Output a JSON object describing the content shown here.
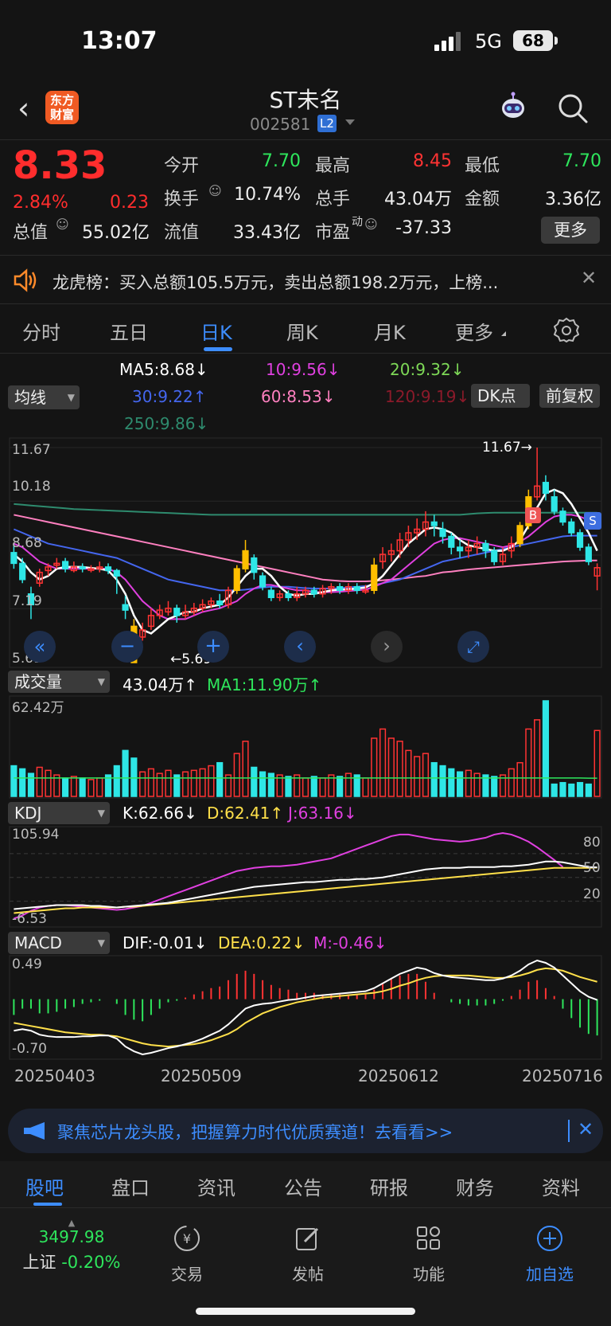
{
  "status": {
    "time": "13:07",
    "network": "5G",
    "battery": "68"
  },
  "header": {
    "stock_name": "ST未名",
    "stock_code": "002581",
    "level_badge": "L2",
    "logo_text": "东方\n财富"
  },
  "quote": {
    "price": "8.33",
    "change_pct": "2.84%",
    "change": "0.23",
    "open_label": "今开",
    "open": "7.70",
    "high_label": "最高",
    "high": "8.45",
    "low_label": "最低",
    "low": "7.70",
    "turnover_label": "换手",
    "turnover": "10.74%",
    "volume_label": "总手",
    "volume": "43.04万",
    "amount_label": "金额",
    "amount": "3.36亿",
    "mktcap_label": "总值",
    "mktcap": "55.02亿",
    "float_label": "流值",
    "float": "33.43亿",
    "pe_label": "市盈",
    "pe_sup": "动",
    "pe": "-37.33",
    "more_label": "更多"
  },
  "notice": {
    "text": "龙虎榜：买入总额105.5万元，卖出总额198.2万元，上榜..."
  },
  "tabs": [
    {
      "label": "分时"
    },
    {
      "label": "五日"
    },
    {
      "label": "日K"
    },
    {
      "label": "周K"
    },
    {
      "label": "月K"
    },
    {
      "label": "更多"
    }
  ],
  "ma_legend": {
    "selector": "均线",
    "ma5": "MA5:8.68↓",
    "ma10": "10:9.56↓",
    "ma20": "20:9.32↓",
    "ma30": "30:9.22↑",
    "ma60": "60:8.53↓",
    "ma120": "120:9.19↓",
    "ma250": "250:9.86↓",
    "dk_button": "DK点",
    "fq_button": "前复权"
  },
  "colors": {
    "up": "#ff3333",
    "down": "#2ee6e6",
    "ma5": "#ffffff",
    "ma10": "#e040e0",
    "ma20": "#7ed957",
    "ma30": "#4466ee",
    "ma60": "#ff80c0",
    "ma120": "#8b1a2a",
    "ma250": "#2e8b6e",
    "accent": "#3d8dff"
  },
  "main_chart": {
    "y_labels": [
      "11.67",
      "10.18",
      "8.68",
      "7.19",
      "5.69"
    ],
    "high_marker": "11.67→",
    "low_marker": "←5.69",
    "b_marker": "B",
    "s_marker": "S"
  },
  "volume": {
    "selector": "成交量",
    "value": "43.04万↑",
    "ma1": "MA1:11.90万↑",
    "max_label": "62.42万"
  },
  "kdj": {
    "selector": "KDJ",
    "k": "K:62.66↓",
    "d": "D:62.41↑",
    "j": "J:63.16↓",
    "top": "105.94",
    "bottom": "-6.53",
    "lv80": "80",
    "lv50": "50",
    "lv20": "20"
  },
  "macd": {
    "selector": "MACD",
    "dif": "DIF:-0.01↓",
    "dea": "DEA:0.22↓",
    "m": "M:-0.46↓",
    "top": "0.49",
    "bottom": "-0.70"
  },
  "dates": [
    "20250403",
    "20250509",
    "20250612",
    "20250716"
  ],
  "chart_data": {
    "type": "candlestick",
    "ylim": [
      5.69,
      11.67
    ],
    "candles": [
      [
        8.75,
        8.45,
        9.0,
        8.3
      ],
      [
        8.45,
        8.0,
        8.6,
        7.9
      ],
      [
        7.6,
        7.3,
        7.8,
        6.9
      ],
      [
        7.9,
        8.2,
        8.3,
        7.8
      ],
      [
        8.25,
        8.35,
        8.45,
        8.1
      ],
      [
        8.4,
        8.45,
        8.6,
        8.3
      ],
      [
        8.5,
        8.3,
        8.6,
        8.2
      ],
      [
        8.25,
        8.35,
        8.5,
        8.2
      ],
      [
        8.35,
        8.3,
        8.45,
        8.2
      ],
      [
        8.3,
        8.3,
        8.4,
        8.2
      ],
      [
        8.3,
        8.35,
        8.5,
        8.2
      ],
      [
        8.35,
        8.25,
        8.45,
        8.15
      ],
      [
        8.25,
        8.1,
        8.3,
        7.6
      ],
      [
        7.3,
        7.15,
        7.55,
        6.9
      ],
      [
        6.7,
        5.69,
        6.9,
        5.69
      ],
      [
        6.4,
        6.6,
        6.8,
        6.3
      ],
      [
        6.7,
        7.0,
        7.2,
        6.6
      ],
      [
        7.0,
        7.15,
        7.3,
        6.9
      ],
      [
        7.1,
        7.2,
        7.4,
        7.0
      ],
      [
        7.2,
        7.0,
        7.3,
        6.8
      ],
      [
        7.0,
        7.1,
        7.3,
        6.9
      ],
      [
        7.1,
        7.2,
        7.35,
        7.0
      ],
      [
        7.2,
        7.3,
        7.45,
        7.1
      ],
      [
        7.3,
        7.4,
        7.5,
        7.2
      ],
      [
        7.4,
        7.3,
        7.6,
        7.2
      ],
      [
        7.3,
        7.7,
        7.8,
        7.2
      ],
      [
        7.7,
        8.3,
        8.4,
        7.6
      ],
      [
        8.3,
        8.8,
        9.1,
        8.2
      ],
      [
        8.6,
        8.2,
        8.7,
        8.0
      ],
      [
        8.1,
        7.8,
        8.2,
        7.7
      ],
      [
        7.7,
        7.5,
        7.8,
        7.4
      ],
      [
        7.5,
        7.6,
        7.7,
        7.4
      ],
      [
        7.6,
        7.5,
        7.7,
        7.4
      ],
      [
        7.5,
        7.6,
        7.8,
        7.4
      ],
      [
        7.6,
        7.7,
        7.8,
        7.5
      ],
      [
        7.7,
        7.6,
        7.8,
        7.5
      ],
      [
        7.6,
        7.75,
        7.85,
        7.5
      ],
      [
        7.75,
        7.8,
        7.9,
        7.6
      ],
      [
        7.8,
        7.7,
        7.9,
        7.6
      ],
      [
        7.7,
        7.8,
        7.9,
        7.6
      ],
      [
        7.8,
        7.7,
        7.9,
        7.6
      ],
      [
        7.7,
        7.7,
        7.85,
        7.6
      ],
      [
        7.7,
        8.4,
        8.6,
        7.6
      ],
      [
        8.5,
        8.7,
        8.9,
        8.3
      ],
      [
        8.7,
        8.8,
        9.0,
        8.5
      ],
      [
        8.8,
        9.1,
        9.3,
        8.6
      ],
      [
        9.1,
        9.3,
        9.5,
        8.9
      ],
      [
        9.3,
        9.4,
        9.7,
        9.1
      ],
      [
        9.4,
        9.6,
        9.9,
        9.2
      ],
      [
        9.6,
        9.5,
        9.8,
        9.2
      ],
      [
        9.4,
        9.2,
        9.6,
        9.0
      ],
      [
        9.2,
        8.9,
        9.3,
        8.7
      ],
      [
        8.9,
        8.8,
        9.1,
        8.6
      ],
      [
        8.8,
        8.9,
        9.1,
        8.6
      ],
      [
        8.9,
        9.0,
        9.2,
        8.7
      ],
      [
        9.0,
        8.8,
        9.1,
        8.6
      ],
      [
        8.8,
        8.5,
        8.9,
        8.4
      ],
      [
        8.5,
        8.7,
        8.9,
        8.4
      ],
      [
        8.8,
        9.0,
        9.2,
        8.6
      ],
      [
        9.0,
        9.5,
        9.6,
        8.9
      ],
      [
        9.5,
        10.3,
        10.5,
        9.4
      ],
      [
        10.3,
        10.6,
        11.67,
        10.2
      ],
      [
        10.7,
        10.4,
        10.9,
        10.2
      ],
      [
        10.3,
        9.9,
        10.5,
        9.8
      ],
      [
        9.9,
        9.6,
        10.0,
        9.5
      ],
      [
        9.6,
        9.3,
        9.7,
        9.2
      ],
      [
        9.3,
        8.9,
        9.4,
        8.8
      ],
      [
        8.9,
        8.5,
        9.0,
        8.4
      ],
      [
        8.1,
        8.33,
        8.45,
        7.7
      ]
    ],
    "ma5": [
      8.7,
      8.5,
      8.2,
      8.0,
      8.1,
      8.3,
      8.35,
      8.35,
      8.35,
      8.32,
      8.3,
      8.25,
      8.0,
      7.6,
      7.0,
      6.6,
      6.5,
      6.7,
      6.9,
      7.0,
      7.1,
      7.1,
      7.2,
      7.25,
      7.3,
      7.5,
      7.8,
      8.1,
      8.3,
      8.3,
      8.1,
      7.8,
      7.6,
      7.55,
      7.6,
      7.6,
      7.65,
      7.7,
      7.72,
      7.73,
      7.75,
      7.78,
      7.9,
      8.1,
      8.4,
      8.7,
      9.0,
      9.2,
      9.4,
      9.45,
      9.4,
      9.3,
      9.1,
      8.95,
      8.9,
      8.85,
      8.8,
      8.8,
      8.9,
      9.1,
      9.5,
      10.0,
      10.4,
      10.5,
      10.4,
      10.1,
      9.7,
      9.3,
      8.8
    ],
    "ma10": [
      9.0,
      8.9,
      8.7,
      8.5,
      8.4,
      8.3,
      8.3,
      8.3,
      8.3,
      8.3,
      8.3,
      8.3,
      8.2,
      8.0,
      7.7,
      7.4,
      7.2,
      7.0,
      6.9,
      6.9,
      6.9,
      7.0,
      7.1,
      7.15,
      7.2,
      7.3,
      7.4,
      7.6,
      7.75,
      7.85,
      7.85,
      7.8,
      7.75,
      7.7,
      7.7,
      7.65,
      7.65,
      7.65,
      7.66,
      7.68,
      7.7,
      7.72,
      7.8,
      7.9,
      8.0,
      8.2,
      8.4,
      8.6,
      8.8,
      9.0,
      9.1,
      9.15,
      9.15,
      9.1,
      9.05,
      9.0,
      8.95,
      8.9,
      8.95,
      9.05,
      9.2,
      9.4,
      9.6,
      9.75,
      9.8,
      9.8,
      9.75,
      9.65,
      9.56
    ],
    "ma30": [
      9.4,
      9.3,
      9.2,
      9.1,
      9.0,
      8.95,
      8.9,
      8.85,
      8.8,
      8.75,
      8.7,
      8.65,
      8.6,
      8.5,
      8.4,
      8.3,
      8.2,
      8.1,
      8.0,
      7.95,
      7.9,
      7.85,
      7.8,
      7.75,
      7.7,
      7.7,
      7.7,
      7.72,
      7.75,
      7.78,
      7.8,
      7.8,
      7.8,
      7.78,
      7.76,
      7.75,
      7.75,
      7.75,
      7.76,
      7.78,
      7.8,
      7.82,
      7.85,
      7.9,
      7.95,
      8.0,
      8.1,
      8.2,
      8.3,
      8.4,
      8.5,
      8.55,
      8.6,
      8.65,
      8.7,
      8.75,
      8.8,
      8.85,
      8.9,
      8.95,
      9.0,
      9.05,
      9.1,
      9.15,
      9.2,
      9.22,
      9.22,
      9.22,
      9.22
    ],
    "ma60": [
      9.8,
      9.75,
      9.7,
      9.65,
      9.6,
      9.55,
      9.5,
      9.45,
      9.4,
      9.35,
      9.3,
      9.25,
      9.2,
      9.15,
      9.1,
      9.05,
      9.0,
      8.95,
      8.9,
      8.85,
      8.8,
      8.75,
      8.7,
      8.65,
      8.6,
      8.55,
      8.5,
      8.45,
      8.4,
      8.35,
      8.3,
      8.25,
      8.2,
      8.15,
      8.1,
      8.05,
      8.0,
      7.98,
      7.96,
      7.95,
      7.95,
      7.95,
      7.96,
      7.98,
      8.0,
      8.02,
      8.05,
      8.08,
      8.1,
      8.15,
      8.2,
      8.22,
      8.25,
      8.28,
      8.3,
      8.32,
      8.34,
      8.36,
      8.38,
      8.4,
      8.42,
      8.44,
      8.46,
      8.48,
      8.5,
      8.51,
      8.52,
      8.53,
      8.53
    ],
    "ma250": [
      10.1,
      10.08,
      10.06,
      10.04,
      10.02,
      10.0,
      9.98,
      9.96,
      9.95,
      9.94,
      9.93,
      9.92,
      9.91,
      9.9,
      9.89,
      9.88,
      9.87,
      9.86,
      9.85,
      9.84,
      9.83,
      9.82,
      9.81,
      9.8,
      9.8,
      9.8,
      9.8,
      9.8,
      9.8,
      9.8,
      9.8,
      9.8,
      9.8,
      9.8,
      9.8,
      9.8,
      9.8,
      9.8,
      9.8,
      9.8,
      9.8,
      9.8,
      9.8,
      9.8,
      9.8,
      9.8,
      9.8,
      9.8,
      9.8,
      9.8,
      9.8,
      9.8,
      9.8,
      9.82,
      9.84,
      9.85,
      9.86,
      9.86,
      9.86,
      9.86,
      9.86,
      9.86,
      9.86,
      9.86,
      9.86,
      9.86,
      9.86,
      9.86,
      9.86
    ],
    "volume": [
      20,
      18,
      15,
      19,
      17,
      14,
      12,
      13,
      12,
      11,
      12,
      14,
      20,
      30,
      25,
      16,
      18,
      15,
      17,
      14,
      16,
      17,
      18,
      20,
      22,
      14,
      28,
      36,
      19,
      16,
      15,
      14,
      13,
      14,
      12,
      13,
      12,
      14,
      13,
      15,
      14,
      12,
      38,
      44,
      38,
      36,
      30,
      26,
      28,
      22,
      20,
      18,
      16,
      17,
      15,
      14,
      13,
      14,
      18,
      22,
      44,
      50,
      62.42,
      8,
      9,
      8,
      9,
      8,
      43.04
    ],
    "volume_ma": [
      12,
      12,
      12,
      12,
      12,
      12,
      12,
      12,
      12,
      12,
      12,
      12,
      12,
      12,
      12,
      12,
      12,
      12,
      12,
      12,
      12,
      12,
      12,
      12,
      12,
      12,
      12,
      12,
      12,
      12,
      12,
      12,
      12,
      12,
      12,
      12,
      12,
      12,
      12,
      12,
      12,
      12,
      12,
      12,
      12,
      12,
      12,
      12,
      12,
      12,
      12,
      12,
      12,
      12,
      12,
      12,
      12,
      12,
      12,
      12,
      12,
      12,
      12,
      12,
      12,
      12,
      12,
      11.9,
      11.9
    ],
    "kdj_k": [
      10,
      11,
      12,
      13,
      14,
      15,
      15,
      15,
      15,
      14,
      14,
      13,
      12,
      13,
      14,
      15,
      16,
      17,
      18,
      20,
      22,
      24,
      26,
      28,
      30,
      32,
      34,
      36,
      38,
      39,
      40,
      41,
      42,
      43,
      44,
      44,
      45,
      46,
      47,
      47,
      48,
      48,
      49,
      50,
      52,
      54,
      56,
      58,
      60,
      61,
      62,
      62,
      62,
      63,
      63,
      63,
      63,
      64,
      64,
      65,
      66,
      68,
      70,
      70,
      69,
      67,
      65,
      63,
      62.66
    ],
    "kdj_d": [
      5,
      6,
      7,
      8,
      9,
      10,
      11,
      11,
      12,
      12,
      12,
      12,
      12,
      13,
      13,
      14,
      15,
      16,
      17,
      18,
      19,
      20,
      21,
      22,
      23,
      24,
      25,
      26,
      27,
      28,
      29,
      30,
      31,
      32,
      33,
      34,
      35,
      36,
      37,
      38,
      39,
      40,
      41,
      42,
      43,
      44,
      45,
      46,
      47,
      48,
      49,
      50,
      51,
      52,
      53,
      54,
      55,
      56,
      57,
      58,
      59,
      60,
      61,
      62,
      62,
      62,
      62,
      62,
      62.41
    ],
    "kdj_j": [
      -2,
      2,
      8,
      12,
      14,
      15,
      15,
      14,
      13,
      12,
      11,
      10,
      9,
      10,
      12,
      14,
      18,
      22,
      26,
      30,
      34,
      38,
      42,
      46,
      50,
      54,
      58,
      60,
      62,
      63,
      64,
      64,
      65,
      66,
      68,
      70,
      72,
      74,
      78,
      82,
      86,
      90,
      94,
      98,
      102,
      104,
      104,
      102,
      100,
      98,
      97,
      96,
      95,
      96,
      98,
      100,
      104,
      105.94,
      104,
      100,
      95,
      88,
      80,
      72,
      63.16
    ],
    "macd_dif": [
      -0.4,
      -0.38,
      -0.4,
      -0.45,
      -0.47,
      -0.48,
      -0.48,
      -0.48,
      -0.47,
      -0.47,
      -0.46,
      -0.46,
      -0.5,
      -0.6,
      -0.66,
      -0.7,
      -0.68,
      -0.65,
      -0.62,
      -0.6,
      -0.57,
      -0.54,
      -0.5,
      -0.45,
      -0.4,
      -0.32,
      -0.22,
      -0.12,
      -0.08,
      -0.06,
      -0.05,
      -0.03,
      -0.01,
      0.0,
      0.02,
      0.04,
      0.05,
      0.06,
      0.07,
      0.08,
      0.09,
      0.1,
      0.14,
      0.2,
      0.26,
      0.32,
      0.36,
      0.4,
      0.38,
      0.33,
      0.3,
      0.28,
      0.27,
      0.26,
      0.25,
      0.24,
      0.24,
      0.26,
      0.3,
      0.36,
      0.44,
      0.49,
      0.46,
      0.4,
      0.3,
      0.2,
      0.1,
      0.03,
      -0.01
    ],
    "macd_dea": [
      -0.3,
      -0.32,
      -0.34,
      -0.36,
      -0.38,
      -0.4,
      -0.42,
      -0.43,
      -0.44,
      -0.45,
      -0.45,
      -0.46,
      -0.47,
      -0.5,
      -0.53,
      -0.56,
      -0.58,
      -0.59,
      -0.6,
      -0.59,
      -0.58,
      -0.57,
      -0.55,
      -0.52,
      -0.48,
      -0.44,
      -0.38,
      -0.3,
      -0.24,
      -0.18,
      -0.14,
      -0.1,
      -0.07,
      -0.04,
      -0.02,
      0.0,
      0.02,
      0.03,
      0.04,
      0.05,
      0.06,
      0.07,
      0.08,
      0.1,
      0.13,
      0.17,
      0.2,
      0.24,
      0.27,
      0.29,
      0.3,
      0.3,
      0.3,
      0.3,
      0.29,
      0.28,
      0.27,
      0.27,
      0.28,
      0.3,
      0.33,
      0.37,
      0.39,
      0.38,
      0.36,
      0.32,
      0.28,
      0.25,
      0.22
    ]
  },
  "banner": {
    "text": "聚焦芯片龙头股，把握算力时代优质赛道！去看看>>"
  },
  "bottom_tabs": [
    {
      "label": "股吧"
    },
    {
      "label": "盘口"
    },
    {
      "label": "资讯"
    },
    {
      "label": "公告"
    },
    {
      "label": "研报"
    },
    {
      "label": "财务"
    },
    {
      "label": "资料"
    }
  ],
  "dock": {
    "index_value": "3497.98",
    "index_name": "上证",
    "index_change": "-0.20%",
    "trade": "交易",
    "post": "发帖",
    "func": "功能",
    "add": "加自选"
  }
}
